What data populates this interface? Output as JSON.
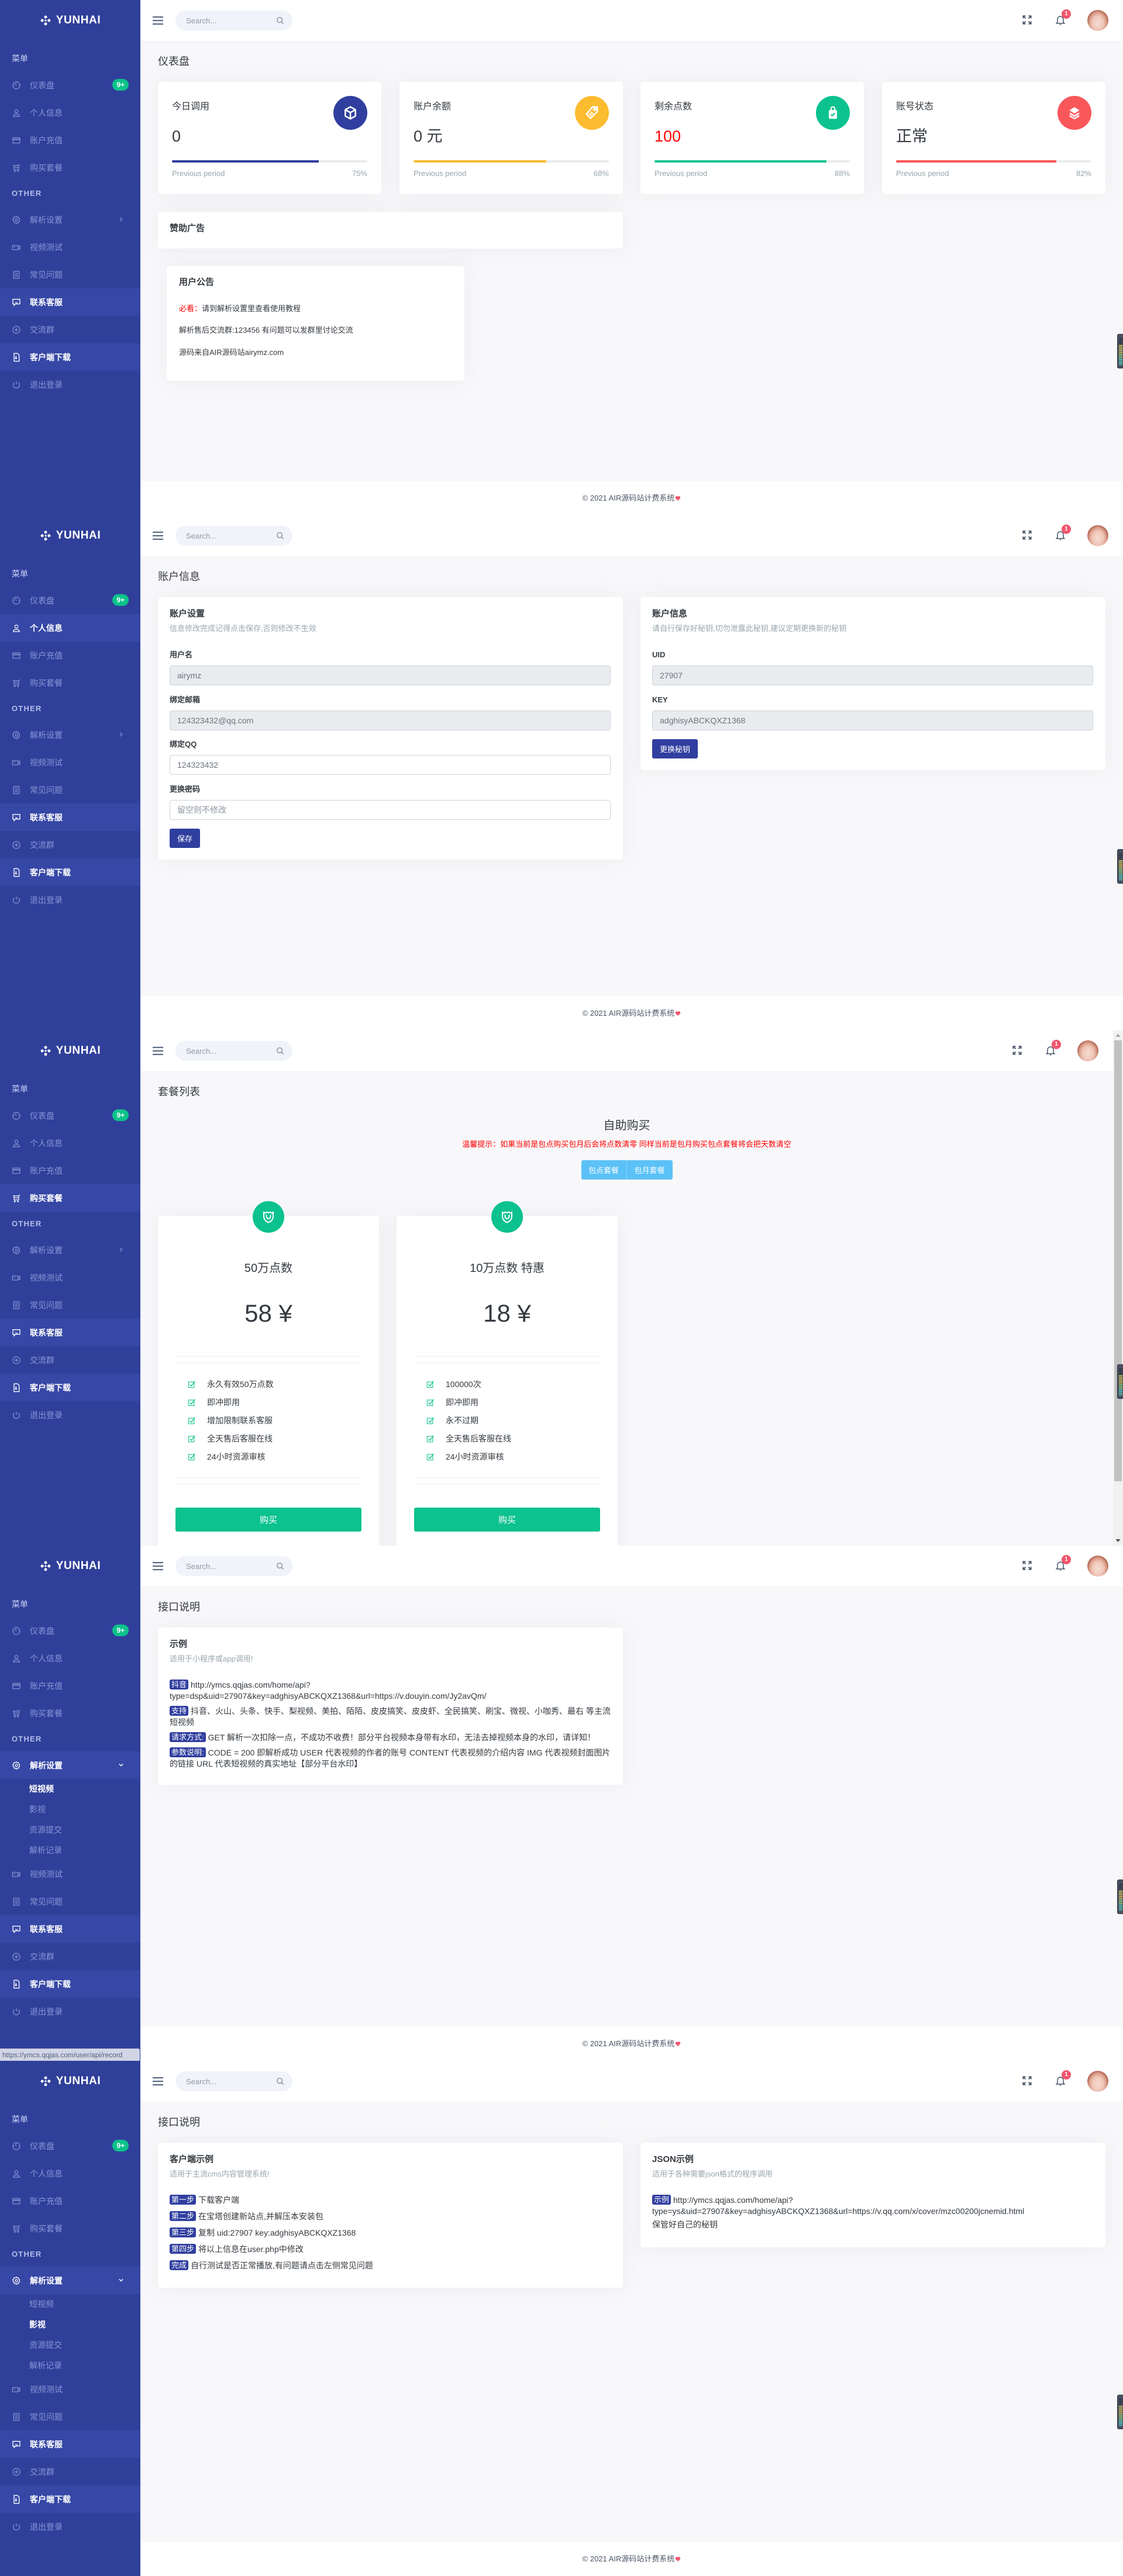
{
  "app": {
    "logo_text": "YUNHAI",
    "search_placeholder": "Search...",
    "notification_count": "1",
    "footer_text": "© 2021 AIR源码站计费系统",
    "colors": {
      "sidebar_bg": "#30409a",
      "sidebar_highlight": "#3647a6",
      "primary": "#303f9f",
      "success": "#0cc28f",
      "info": "#5bc1f7",
      "danger_text": "#ff0000",
      "heart": "#f1556c",
      "content_bg": "#f8f8fa"
    }
  },
  "sidebar": {
    "menu_title": "菜单",
    "other_title": "OTHER",
    "main_items": [
      {
        "key": "dashboard",
        "label": "仪表盘",
        "icon": "dashboard-icon",
        "badge": "9+"
      },
      {
        "key": "profile",
        "label": "个人信息",
        "icon": "user-icon"
      },
      {
        "key": "recharge",
        "label": "账户充值",
        "icon": "credit-card-icon"
      },
      {
        "key": "buy",
        "label": "购买套餐",
        "icon": "cart-icon"
      }
    ],
    "other_items": [
      {
        "key": "parse",
        "label": "解析设置",
        "icon": "gear-icon",
        "has_submenu": true
      },
      {
        "key": "video_test",
        "label": "视频测试",
        "icon": "video-camera-icon"
      },
      {
        "key": "faq",
        "label": "常见问题",
        "icon": "document-icon"
      },
      {
        "key": "support",
        "label": "联系客服",
        "icon": "chat-icon",
        "highlight": true
      },
      {
        "key": "group",
        "label": "交流群",
        "icon": "plus-circle-icon"
      },
      {
        "key": "download",
        "label": "客户端下载",
        "icon": "file-download-icon",
        "highlight": true
      },
      {
        "key": "logout",
        "label": "退出登录",
        "icon": "power-icon"
      }
    ],
    "parse_submenu": [
      {
        "key": "short_video",
        "label": "短视频"
      },
      {
        "key": "movie",
        "label": "影视"
      },
      {
        "key": "submit",
        "label": "资源提交"
      },
      {
        "key": "records",
        "label": "解析记录"
      }
    ]
  },
  "screens": [
    {
      "name": "dashboard",
      "sidebar_active": "",
      "submenu_open": false,
      "submenu_active": ""
    },
    {
      "name": "account",
      "sidebar_active": "profile",
      "submenu_open": false,
      "submenu_active": ""
    },
    {
      "name": "plans",
      "sidebar_active": "buy",
      "submenu_open": false,
      "submenu_active": "",
      "scrollbar": {
        "visible_fraction": 0.89,
        "position": 0
      }
    },
    {
      "name": "api-doc",
      "sidebar_active": "parse",
      "submenu_open": true,
      "submenu_active": "short_video"
    },
    {
      "name": "client-doc",
      "sidebar_active": "parse",
      "submenu_open": true,
      "submenu_active": "movie"
    }
  ],
  "dashboard": {
    "title": "仪表盘",
    "stats": [
      {
        "label": "今日调用",
        "value": "0",
        "icon": "cube-icon",
        "color": "#303f9f",
        "progress": 75,
        "progress_label": "75%",
        "caption": "Previous period"
      },
      {
        "label": "账户余额",
        "value": "0 元",
        "icon": "tag-icon",
        "color": "#fbbc30",
        "progress": 68,
        "progress_label": "68%",
        "caption": "Previous period"
      },
      {
        "label": "剩余点数",
        "value": "100",
        "value_color": "#ff0000",
        "icon": "shopping-bag-check-icon",
        "color": "#0cc28f",
        "progress": 88,
        "progress_label": "88%",
        "caption": "Previous period"
      },
      {
        "label": "账号状态",
        "value": "正常",
        "icon": "layers-icon",
        "color": "#f9575a",
        "progress": 82,
        "progress_label": "82%",
        "caption": "Previous period"
      }
    ],
    "sponsor_title": "赞助广告",
    "notice": {
      "title": "用户公告",
      "highlight_label": "必看：",
      "highlight_text": "请到解析设置里查看使用教程",
      "lines": [
        "解析售后交流群:123456 有问题可以发群里讨论交流",
        "源码来自AIR源码站airymz.com"
      ]
    }
  },
  "account": {
    "title": "账户信息",
    "settings": {
      "title": "账户设置",
      "subtitle": "信息修改完成记得点击保存,否则修改不生效",
      "fields": [
        {
          "label": "用户名",
          "value": "airymz"
        },
        {
          "label": "绑定邮箱",
          "value": "124323432@qq.com"
        },
        {
          "label": "绑定QQ",
          "value": "124323432"
        },
        {
          "label": "更换密码",
          "value": "",
          "placeholder": "留空则不修改"
        }
      ],
      "save_label": "保存"
    },
    "info": {
      "title": "账户信息",
      "subtitle": "请自行保存好秘钥,切勿泄露此秘钥,建议定期更换新的秘钥",
      "fields": [
        {
          "label": "UID",
          "value": "27907"
        },
        {
          "label": "KEY",
          "value": "adghisyABCKQXZ1368"
        }
      ],
      "reset_key_label": "更换秘钥"
    }
  },
  "plans": {
    "title": "套餐列表",
    "heading": "自助购买",
    "notice": "温馨提示：如果当前是包点购买包月后会将点数清零 同样当前是包月购买包点套餐将会把天数清空",
    "tabs": [
      "包点套餐",
      "包月套餐"
    ],
    "items": [
      {
        "name": "50万点数",
        "price": "58 ¥",
        "features": [
          "永久有效50万点数",
          "即冲即用",
          "增加限制联系客服",
          "全天售后客服在线",
          "24小时资源审核"
        ],
        "button": "购买"
      },
      {
        "name": "10万点数 特惠",
        "price": "18 ¥",
        "features": [
          "100000次",
          "即冲即用",
          "永不过期",
          "全天售后客服在线",
          "24小时资源审核"
        ],
        "button": "购买"
      }
    ]
  },
  "api_doc": {
    "title": "接口说明",
    "card_title": "示例",
    "card_subtitle": "适用于小程序或app调用!",
    "rows": [
      {
        "tag": "抖音",
        "text": "http://ymcs.qqjas.com/home/api?type=dsp&uid=27907&key=adghisyABCKQXZ1368&url=https://v.douyin.com/Jy2avQm/"
      },
      {
        "tag": "支持",
        "text": "抖音、火山、头条、快手、梨视频、美拍、陌陌、皮皮搞笑、皮皮虾、全民搞笑、刷宝、微视、小咖秀、最右 等主流短视频"
      },
      {
        "tag": "请求方式:",
        "text": "GET 解析一次扣除一点，不成功不收费！部分平台视频本身带有水印，无法去掉视频本身的水印，请详知！"
      },
      {
        "tag": "参数说明:",
        "text": "CODE = 200 即解析成功 USER 代表视频的作者的账号 CONTENT 代表视频的介绍内容 IMG 代表视频封面图片的链接 URL 代表短视频的真实地址【部分平台水印】"
      }
    ],
    "browser_status_url": "https://ymcs.qqjas.com/user/api/record"
  },
  "client_doc": {
    "title": "接口说明",
    "client": {
      "title": "客户端示例",
      "subtitle": "适用于主流cms内容管理系统!",
      "steps": [
        {
          "tag": "第一步",
          "text": "下载客户端"
        },
        {
          "tag": "第二步",
          "text": "在宝塔创建新站点,并解压本安装包"
        },
        {
          "tag": "第三步",
          "text": "复制 uid:27907 key:adghisyABCKQXZ1368"
        },
        {
          "tag": "第四步",
          "text": "将以上信息在user.php中修改"
        },
        {
          "tag": "完成",
          "text": "自行测试是否正常播放,有问题请点击左侧常见问题"
        }
      ]
    },
    "json": {
      "title": "JSON示例",
      "subtitle": "适用于各种需要json格式的程序调用",
      "example_tag": "示例",
      "example_text": "http://ymcs.qqjas.com/home/api?type=ys&uid=27907&key=adghisyABCKQXZ1368&url=https://v.qq.com/x/cover/mzc00200jcnemid.html",
      "note": "保管好自己的秘钥"
    }
  }
}
